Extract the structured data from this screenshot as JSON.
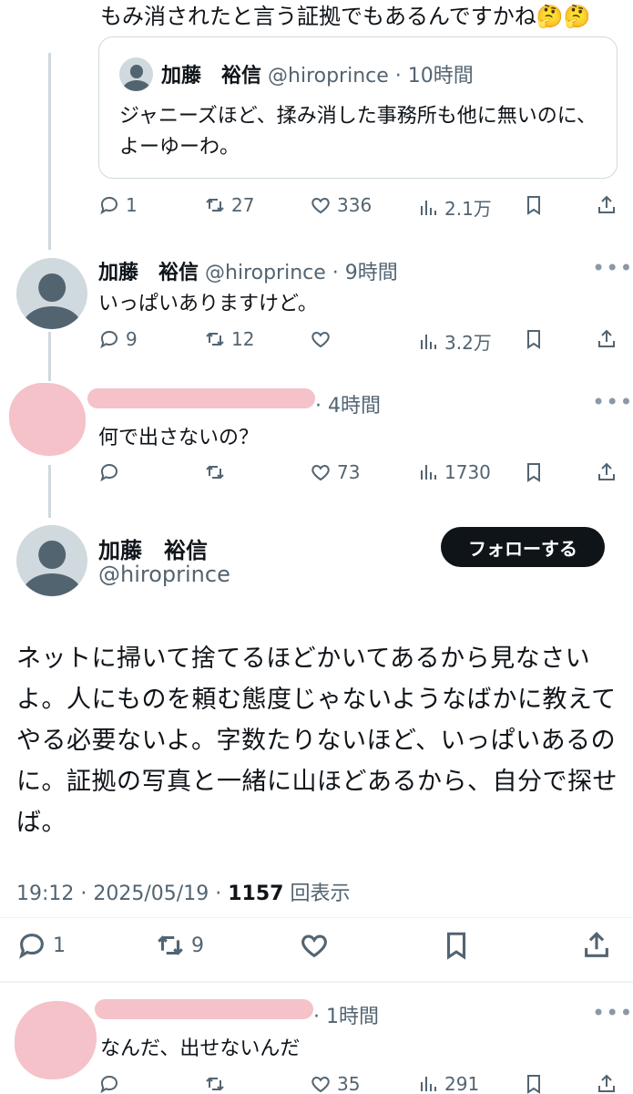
{
  "top_partial_text": "もみ消されたと言う証拠でもあるんですかね🤔🤔",
  "quote": {
    "name": "加藤　裕信",
    "handle": "@hiroprince",
    "time": "· 10時間",
    "text": "ジャニーズほど、揉み消した事務所も他に無いのに、よーゆーわ。"
  },
  "post1_actions": {
    "replies": "1",
    "reposts": "27",
    "likes": "336",
    "views": "2.1万"
  },
  "reply1": {
    "name": "加藤　裕信",
    "handle": "@hiroprince",
    "time": "· 9時間",
    "text": "いっぱいありますけど。",
    "replies": "9",
    "reposts": "12",
    "likes": "",
    "views": "3.2万"
  },
  "reply2": {
    "time": "· 4時間",
    "text": "何で出さないの？",
    "replies": "",
    "reposts": "",
    "likes": "73",
    "views": "1730"
  },
  "main": {
    "name": "加藤　裕信",
    "handle": "@hiroprince",
    "follow_label": "フォローする",
    "body": "ネットに掃いて捨てるほどかいてあるから見なさいよ。人にものを頼む態度じゃないようなばかに教えてやる必要ないよ。字数たりないほど、いっぱいあるのに。証拠の写真と一緒に山ほどあるから、自分で探せば。",
    "time": "19:12",
    "date": "2025/05/19",
    "views_count": "1157",
    "views_label": "回表示",
    "replies": "1",
    "reposts": "9"
  },
  "reply3": {
    "time": "· 1時間",
    "text": "なんだ、出せないんだ",
    "likes": "35",
    "views": "291"
  },
  "colors": {
    "pink_redaction": "#f4c2c8",
    "follow_bg": "#0f1419",
    "muted": "#536471"
  }
}
